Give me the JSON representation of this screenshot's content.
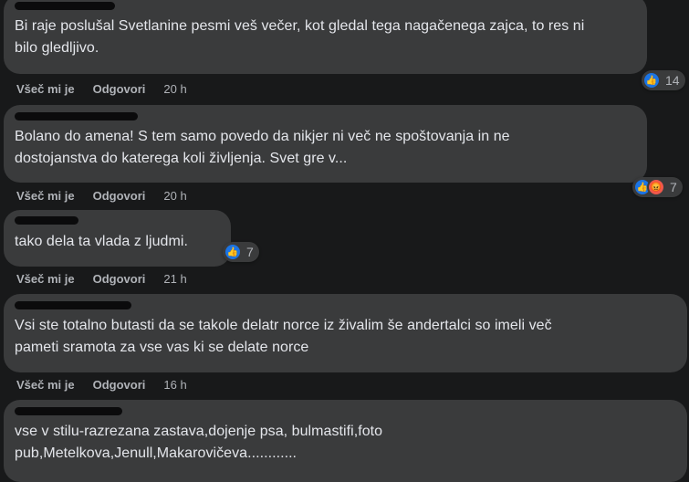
{
  "comments": [
    {
      "author": "",
      "text_lines": [
        "Bi raje poslušal Svetlanine pesmi veš večer, kot gledal tega nagačenega zajca, to res ni",
        "bilo gledljivo."
      ],
      "like_label": "Všeč mi je",
      "reply_label": "Odgovori",
      "time": "20 h",
      "reactions": [
        "like"
      ],
      "reaction_count": "14"
    },
    {
      "author": "",
      "text_lines": [
        "Bolano do amena! S tem samo povedo da nikjer ni več ne spoštovanja in ne",
        "dostojanstva do katerega koli življenja. Svet gre v..."
      ],
      "like_label": "Všeč mi je",
      "reply_label": "Odgovori",
      "time": "20 h",
      "reactions": [
        "like",
        "angry"
      ],
      "reaction_count": "7"
    },
    {
      "author": "",
      "text_lines": [
        "tako dela ta vlada z ljudmi."
      ],
      "like_label": "Všeč mi je",
      "reply_label": "Odgovori",
      "time": "21 h",
      "reactions": [
        "like"
      ],
      "reaction_count": "7"
    },
    {
      "author": "",
      "text_lines": [
        "Vsi ste totalno butasti da se takole delatr norce iz živalim še andertalci so imeli več",
        "pameti sramota za vse vas ki se delate norce"
      ],
      "like_label": "Všeč mi je",
      "reply_label": "Odgovori",
      "time": "16 h",
      "reactions": [],
      "reaction_count": ""
    },
    {
      "author": "",
      "text_lines": [
        "vse v stilu-razrezana zastava,dojenje psa, bulmastifi,foto",
        "pub,Metelkova,Jenull,Makarovičeva............"
      ],
      "like_label": "",
      "reply_label": "",
      "time": "",
      "reactions": [],
      "reaction_count": ""
    }
  ],
  "colors": {
    "background": "#18191a",
    "bubble": "#3a3b3c",
    "text": "#e4e6eb",
    "secondary_text": "#b0b3b8",
    "like_blue": "#1b74e4",
    "angry_orange": "#f0584b"
  },
  "icons": [
    "like-icon",
    "angry-icon"
  ]
}
